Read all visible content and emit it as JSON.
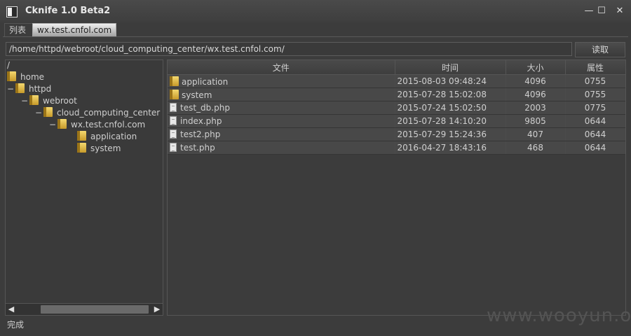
{
  "window": {
    "title": "Cknife 1.0 Beta2",
    "minimize": "—",
    "maximize": "☐",
    "close": "✕"
  },
  "tabs": [
    {
      "label": "列表"
    },
    {
      "label": "wx.test.cnfol.com"
    }
  ],
  "pathbar": {
    "value": "/home/httpd/webroot/cloud_computing_center/wx.test.cnfol.com/",
    "read_label": "读取"
  },
  "tree": {
    "root": "/",
    "nodes": [
      {
        "label": "home",
        "toggle": ""
      },
      {
        "label": "httpd",
        "toggle": "−"
      },
      {
        "label": "webroot",
        "toggle": "−"
      },
      {
        "label": "cloud_computing_center",
        "toggle": "−"
      },
      {
        "label": "wx.test.cnfol.com",
        "toggle": "−"
      },
      {
        "label": "application",
        "toggle": ""
      },
      {
        "label": "system",
        "toggle": ""
      }
    ]
  },
  "file_table": {
    "columns": [
      "文件",
      "时间",
      "大小",
      "属性"
    ],
    "rows": [
      {
        "name": "application",
        "type": "folder",
        "time": "2015-08-03 09:48:24",
        "size": "4096",
        "attr": "0755"
      },
      {
        "name": "system",
        "type": "folder",
        "time": "2015-07-28 15:02:08",
        "size": "4096",
        "attr": "0755"
      },
      {
        "name": "test_db.php",
        "type": "file",
        "time": "2015-07-24 15:02:50",
        "size": "2003",
        "attr": "0775"
      },
      {
        "name": "index.php",
        "type": "file",
        "time": "2015-07-28 14:10:20",
        "size": "9805",
        "attr": "0644"
      },
      {
        "name": "test2.php",
        "type": "file",
        "time": "2015-07-29 15:24:36",
        "size": "407",
        "attr": "0644"
      },
      {
        "name": "test.php",
        "type": "file",
        "time": "2016-04-27 18:43:16",
        "size": "468",
        "attr": "0644"
      }
    ]
  },
  "status": "完成",
  "watermark": "www.wooyun.org",
  "colors": {
    "background": "#3c3c3c",
    "row": "#484848",
    "active_tab": "#d0d0d0",
    "folder": "#e6c04c"
  }
}
